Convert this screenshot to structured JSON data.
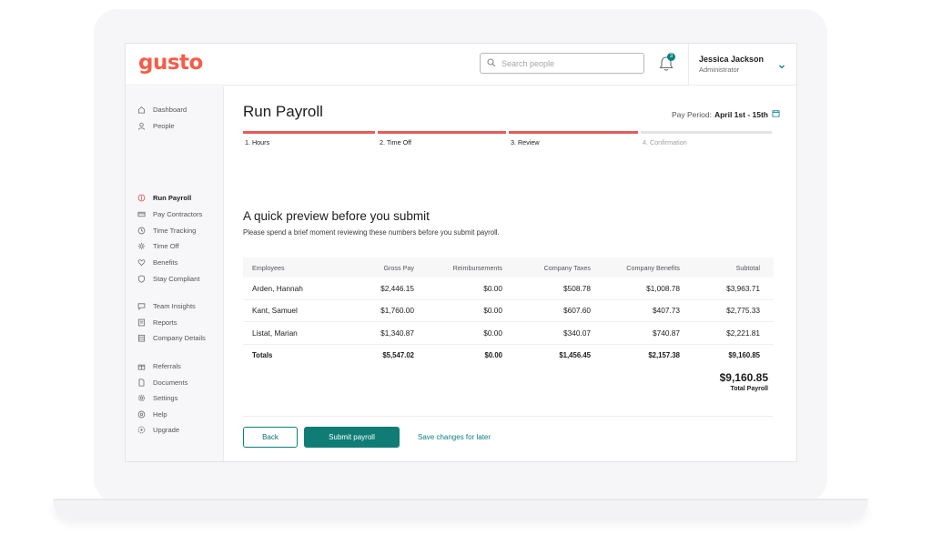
{
  "app": {
    "logo": "gusto"
  },
  "header": {
    "search_placeholder": "Search people",
    "notification_count": "3",
    "user_name": "Jessica Jackson",
    "user_role": "Administrator"
  },
  "sidebar": {
    "items": [
      {
        "label": "Dashboard",
        "icon": "home-icon",
        "active": false
      },
      {
        "label": "People",
        "icon": "person-icon",
        "active": false
      },
      {
        "label": "Run Payroll",
        "icon": "payroll-icon",
        "active": true
      },
      {
        "label": "Pay Contractors",
        "icon": "card-icon",
        "active": false
      },
      {
        "label": "Time Tracking",
        "icon": "clock-icon",
        "active": false
      },
      {
        "label": "Time Off",
        "icon": "sun-icon",
        "active": false
      },
      {
        "label": "Benefits",
        "icon": "heart-icon",
        "active": false
      },
      {
        "label": "Stay Compliant",
        "icon": "shield-icon",
        "active": false
      },
      {
        "label": "Team Insights",
        "icon": "chat-icon",
        "active": false
      },
      {
        "label": "Reports",
        "icon": "reports-icon",
        "active": false
      },
      {
        "label": "Company Details",
        "icon": "building-icon",
        "active": false
      },
      {
        "label": "Referrals",
        "icon": "gift-icon",
        "active": false
      },
      {
        "label": "Documents",
        "icon": "document-icon",
        "active": false
      },
      {
        "label": "Settings",
        "icon": "gear-icon",
        "active": false
      },
      {
        "label": "Help",
        "icon": "help-icon",
        "active": false
      },
      {
        "label": "Upgrade",
        "icon": "upgrade-icon",
        "active": false
      }
    ]
  },
  "main": {
    "title": "Run Payroll",
    "pay_period_label": "Pay Period:",
    "pay_period_value": "April 1st - 15th",
    "steps": [
      {
        "label": "1. Hours",
        "state": "done"
      },
      {
        "label": "2. Time Off",
        "state": "done"
      },
      {
        "label": "3. Review",
        "state": "done"
      },
      {
        "label": "4. Confirmation",
        "state": "future"
      }
    ],
    "heading": "A quick preview before you submit",
    "subheading": "Please spend a brief moment reviewing these numbers before you submit payroll.",
    "table": {
      "columns": [
        "Employees",
        "Gross Pay",
        "Reimbursements",
        "Company Taxes",
        "Company Benefits",
        "Subtotal"
      ],
      "rows": [
        [
          "Arden, Hannah",
          "$2,446.15",
          "$0.00",
          "$508.78",
          "$1,008.78",
          "$3,963.71"
        ],
        [
          "Kant, Samuel",
          "$1,760.00",
          "$0.00",
          "$607.60",
          "$407.73",
          "$2,775.33"
        ],
        [
          "Listat, Marian",
          "$1,340.87",
          "$0.00",
          "$340.07",
          "$740.87",
          "$2,221.81"
        ]
      ],
      "totals": [
        "Totals",
        "$5,547.02",
        "$0.00",
        "$1,456.45",
        "$2,157.38",
        "$9,160.85"
      ]
    },
    "grand_total": "$9,160.85",
    "grand_total_label": "Total Payroll"
  },
  "footer": {
    "back_label": "Back",
    "submit_label": "Submit payroll",
    "save_label": "Save changes for later"
  },
  "colors": {
    "brand": "#f45d48",
    "primary": "#0f7d75",
    "progress": "#e45c5a"
  }
}
